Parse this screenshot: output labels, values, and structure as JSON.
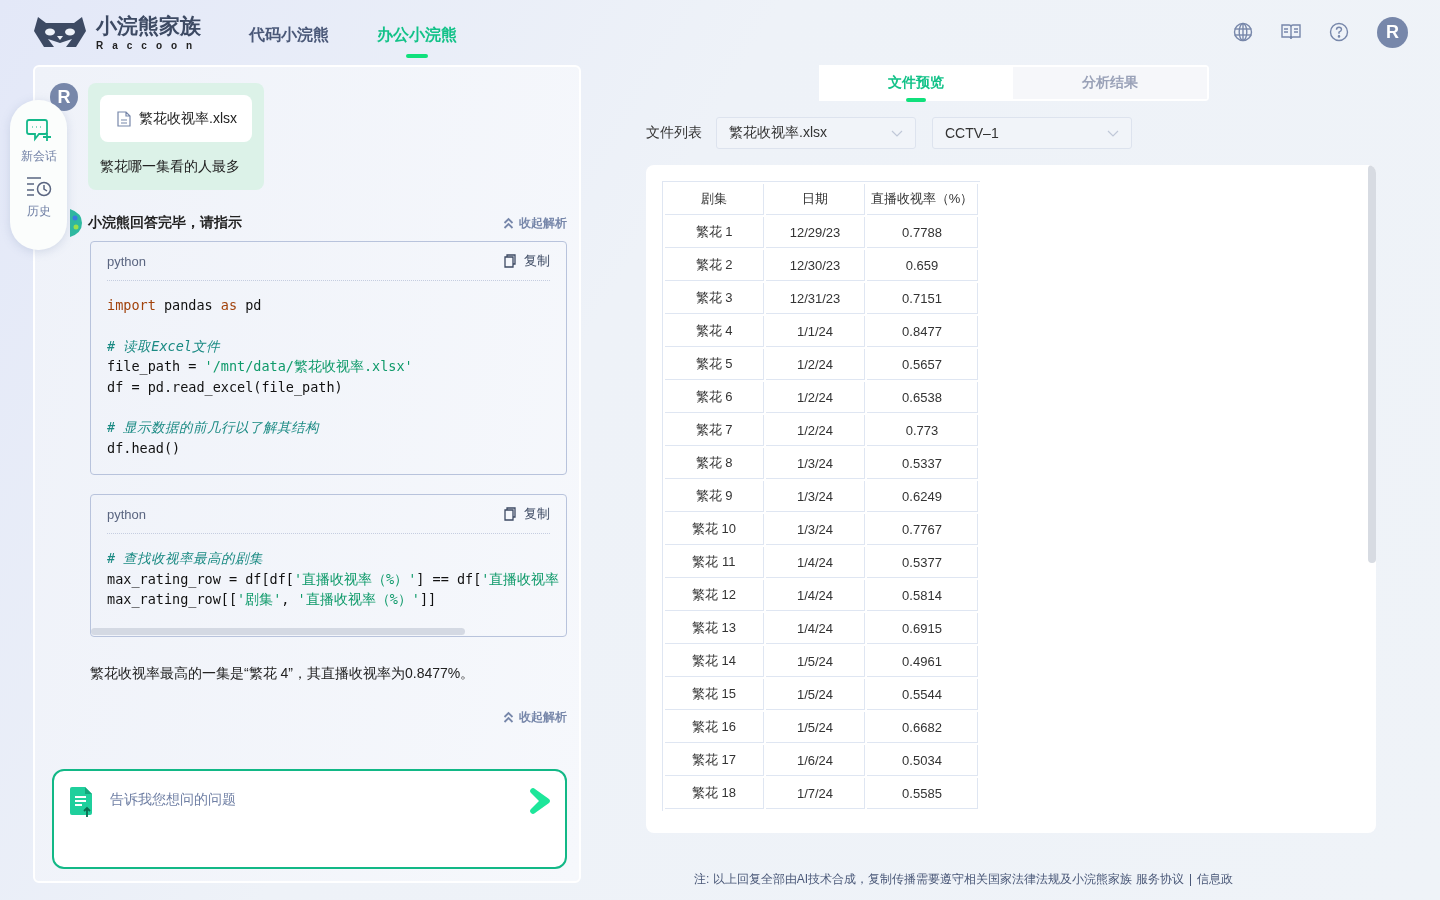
{
  "header": {
    "logo": {
      "title": "小浣熊家族",
      "subtitle": "Raccoon"
    },
    "nav": [
      {
        "label": "代码小浣熊",
        "selected": false
      },
      {
        "label": "办公小浣熊",
        "selected": true
      }
    ],
    "avatar": "R"
  },
  "sidebar": {
    "items": [
      {
        "label": "新会话",
        "kind": "new"
      },
      {
        "label": "历史",
        "kind": "history"
      }
    ]
  },
  "chat": {
    "user": {
      "avatar": "R",
      "file": "繁花收视率.xlsx",
      "message": "繁花哪一集看的人最多"
    },
    "reply": {
      "status": "小浣熊回答完毕，请指示",
      "collapse": "收起解析",
      "code_blocks": [
        {
          "language": "python",
          "copy": "复制",
          "overflow": false,
          "groups": [
            [
              [
                {
                  "text": "import",
                  "kind": "keyword"
                },
                {
                  "text": " pandas ",
                  "kind": "plain"
                },
                {
                  "text": "as",
                  "kind": "keyword"
                },
                {
                  "text": " pd",
                  "kind": "plain"
                }
              ]
            ],
            [
              [
                {
                  "text": "# 读取Excel文件",
                  "kind": "comment"
                }
              ],
              [
                {
                  "text": "file_path = ",
                  "kind": "plain"
                },
                {
                  "text": "'/mnt/data/繁花收视率.xlsx'",
                  "kind": "string"
                }
              ],
              [
                {
                  "text": "df = pd.read_excel(file_path)",
                  "kind": "plain"
                }
              ]
            ],
            [
              [
                {
                  "text": "# 显示数据的前几行以了解其结构",
                  "kind": "comment"
                }
              ],
              [
                {
                  "text": "df.head()",
                  "kind": "plain"
                }
              ]
            ]
          ]
        },
        {
          "language": "python",
          "copy": "复制",
          "overflow": true,
          "groups": [
            [
              [
                {
                  "text": "# 查找收视率最高的剧集",
                  "kind": "comment"
                }
              ],
              [
                {
                  "text": "max_rating_row = df[df[",
                  "kind": "plain"
                },
                {
                  "text": "'直播收视率（%）'",
                  "kind": "string"
                },
                {
                  "text": "] == df[",
                  "kind": "plain"
                },
                {
                  "text": "'直播收视率",
                  "kind": "string"
                }
              ],
              [
                {
                  "text": "max_rating_row[[",
                  "kind": "plain"
                },
                {
                  "text": "'剧集'",
                  "kind": "string"
                },
                {
                  "text": ", ",
                  "kind": "plain"
                },
                {
                  "text": "'直播收视率（%）'",
                  "kind": "string"
                },
                {
                  "text": "]]",
                  "kind": "plain"
                }
              ]
            ]
          ]
        }
      ],
      "answer": "繁花收视率最高的一集是“繁花 4”，其直播收视率为0.8477%。",
      "collapse_bottom": "收起解析"
    },
    "input": {
      "placeholder": "告诉我您想问的问题"
    }
  },
  "preview": {
    "tabs": [
      {
        "label": "文件预览",
        "selected": true
      },
      {
        "label": "分析结果",
        "selected": false
      }
    ],
    "file_list": {
      "label": "文件列表",
      "file": "繁花收视率.xlsx",
      "sheet": "CCTV–1"
    },
    "table": {
      "columns": [
        "剧集",
        "日期",
        "直播收视率（%）"
      ],
      "rows": [
        [
          "繁花 1",
          "12/29/23",
          "0.7788"
        ],
        [
          "繁花 2",
          "12/30/23",
          "0.659"
        ],
        [
          "繁花 3",
          "12/31/23",
          "0.7151"
        ],
        [
          "繁花 4",
          "1/1/24",
          "0.8477"
        ],
        [
          "繁花 5",
          "1/2/24",
          "0.5657"
        ],
        [
          "繁花 6",
          "1/2/24",
          "0.6538"
        ],
        [
          "繁花 7",
          "1/2/24",
          "0.773"
        ],
        [
          "繁花 8",
          "1/3/24",
          "0.5337"
        ],
        [
          "繁花 9",
          "1/3/24",
          "0.6249"
        ],
        [
          "繁花 10",
          "1/3/24",
          "0.7767"
        ],
        [
          "繁花 11",
          "1/4/24",
          "0.5377"
        ],
        [
          "繁花 12",
          "1/4/24",
          "0.5814"
        ],
        [
          "繁花 13",
          "1/4/24",
          "0.6915"
        ],
        [
          "繁花 14",
          "1/5/24",
          "0.4961"
        ],
        [
          "繁花 15",
          "1/5/24",
          "0.5544"
        ],
        [
          "繁花 16",
          "1/5/24",
          "0.6682"
        ],
        [
          "繁花 17",
          "1/6/24",
          "0.5034"
        ],
        [
          "繁花 18",
          "1/7/24",
          "0.5585"
        ]
      ]
    }
  },
  "footer": {
    "note": "注: 以上回复全部由AI技术合成，复制传播需要遵守相关国家法律法规及小浣熊家族",
    "links": [
      "服务协议",
      "信息政"
    ]
  }
}
